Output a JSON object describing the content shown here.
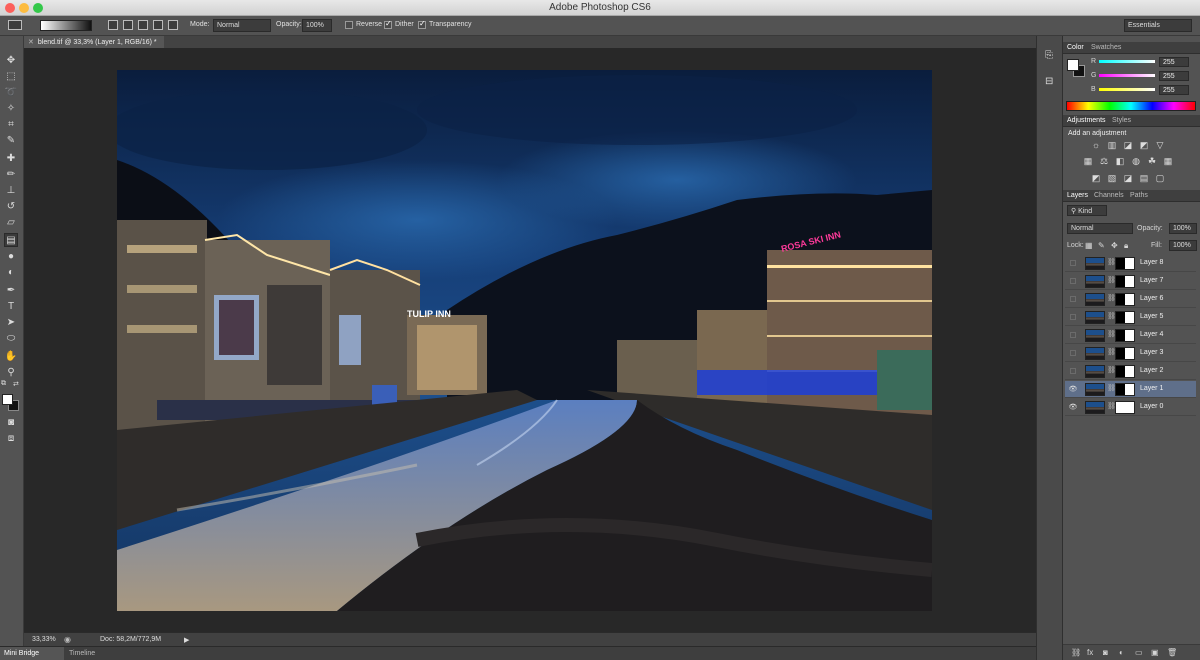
{
  "window": {
    "title": "Adobe Photoshop CS6"
  },
  "options": {
    "mode_label": "Mode:",
    "mode_value": "Normal",
    "opacity_label": "Opacity:",
    "opacity_value": "100%",
    "reverse_label": "Reverse",
    "dither_label": "Dither",
    "transparency_label": "Transparency",
    "workspace": "Essentials"
  },
  "document": {
    "tab_label": "blend.tif @ 33,3% (Layer 1, RGB/16) *"
  },
  "status": {
    "zoom": "33,33%",
    "doc_size": "Doc: 58,2M/772,9M"
  },
  "bottom_tabs": [
    "Mini Bridge",
    "Timeline"
  ],
  "color_panel": {
    "tabs": [
      "Color",
      "Swatches"
    ],
    "channels": [
      {
        "label": "R",
        "value": "255"
      },
      {
        "label": "G",
        "value": "255"
      },
      {
        "label": "B",
        "value": "255"
      }
    ]
  },
  "adjustments_panel": {
    "tabs": [
      "Adjustments",
      "Styles"
    ],
    "heading": "Add an adjustment"
  },
  "layers_panel": {
    "tabs": [
      "Layers",
      "Channels",
      "Paths"
    ],
    "filter_kind": "Kind",
    "blend_mode": "Normal",
    "opacity_label": "Opacity:",
    "opacity_value": "100%",
    "lock_label": "Lock:",
    "fill_label": "Fill:",
    "fill_value": "100%",
    "layers": [
      {
        "name": "Layer 8",
        "visible": false,
        "active": false
      },
      {
        "name": "Layer 7",
        "visible": false,
        "active": false
      },
      {
        "name": "Layer 6",
        "visible": false,
        "active": false
      },
      {
        "name": "Layer 5",
        "visible": false,
        "active": false
      },
      {
        "name": "Layer 4",
        "visible": false,
        "active": false
      },
      {
        "name": "Layer 3",
        "visible": false,
        "active": false
      },
      {
        "name": "Layer 2",
        "visible": false,
        "active": false
      },
      {
        "name": "Layer 1",
        "visible": true,
        "active": true
      },
      {
        "name": "Layer 0",
        "visible": true,
        "active": false
      }
    ]
  },
  "colors": {
    "active_layer": "#5f6f8a",
    "panel_bg": "#535353",
    "canvas_bg": "#282828"
  }
}
